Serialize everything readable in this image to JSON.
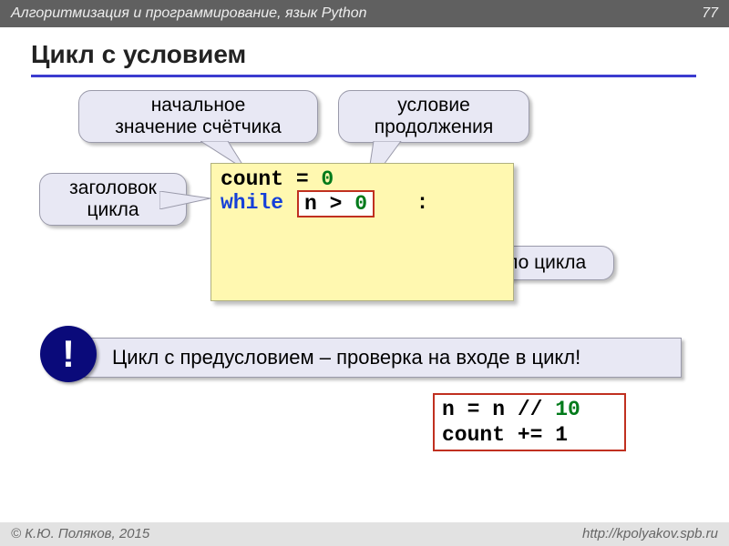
{
  "header": {
    "course": "Алгоритмизация и программирование, язык Python",
    "page": "77"
  },
  "title": "Цикл с условием",
  "callouts": {
    "initial": "начальное\nзначение счётчика",
    "condition": "условие\nпродолжения",
    "header_label": "заголовок\nцикла",
    "body_label": "тело цикла"
  },
  "code": {
    "l1a": "count = ",
    "l1z": "0",
    "l2a": "while",
    "l2cond": "n > ",
    "l2z": "0",
    "l2colon": " :",
    "body1a": "n = n // ",
    "body1z": "10",
    "body2": "count += 1"
  },
  "note": {
    "bang": "!",
    "text": "Цикл с предусловием – проверка на входе в цикл!"
  },
  "footer": {
    "author": "© К.Ю. Поляков, 2015",
    "url": "http://kpolyakov.spb.ru"
  }
}
